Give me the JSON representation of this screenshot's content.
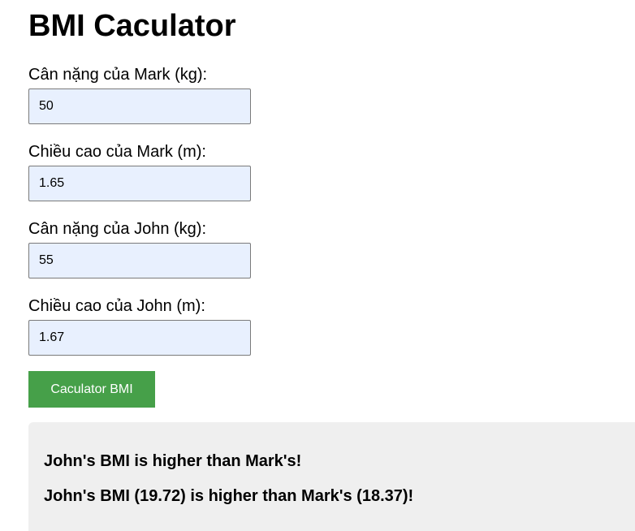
{
  "page": {
    "title": "BMI Caculator"
  },
  "form": {
    "mark_weight": {
      "label": "Cân nặng của Mark (kg):",
      "value": "50"
    },
    "mark_height": {
      "label": "Chiều cao của Mark (m):",
      "value": "1.65"
    },
    "john_weight": {
      "label": "Cân nặng của John (kg):",
      "value": "55"
    },
    "john_height": {
      "label": "Chiều cao của John (m):",
      "value": "1.67"
    },
    "button_label": "Caculator BMI"
  },
  "result": {
    "line1": "John's BMI is higher than Mark's!",
    "line2": "John's BMI (19.72) is higher than Mark's (18.37)!"
  },
  "colors": {
    "button_bg": "#46a049",
    "input_bg": "#e8f0fe",
    "result_bg": "#efefef"
  }
}
